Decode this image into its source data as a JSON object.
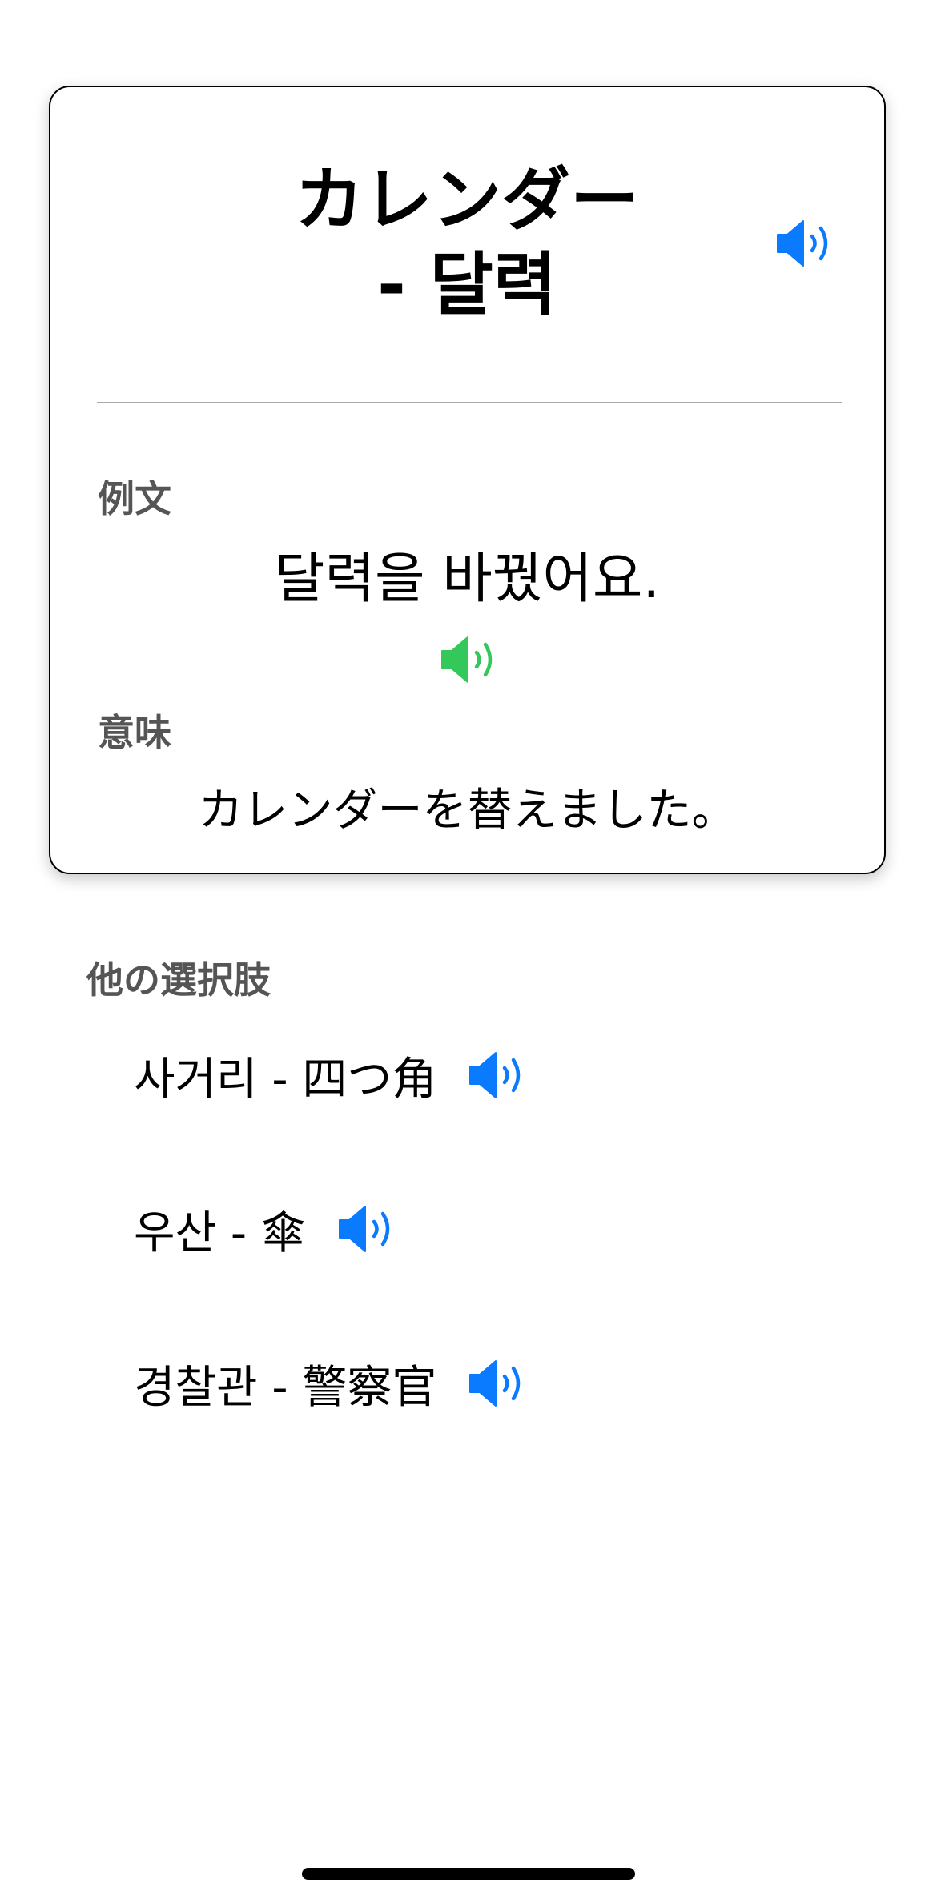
{
  "card": {
    "title_line1": "カレンダー",
    "title_line2": "- 달력",
    "example_label": "例文",
    "example_text": "달력을 바꿨어요.",
    "meaning_label": "意味",
    "meaning_text": "カレンダーを替えました。"
  },
  "others": {
    "label": "他の選択肢",
    "options": [
      {
        "text": "사거리 - 四つ角"
      },
      {
        "text": "우산 - 傘"
      },
      {
        "text": "경찰관 - 警察官"
      }
    ]
  },
  "icons": {
    "speaker": "speaker-icon"
  },
  "colors": {
    "speaker_blue": "#0A7AFF",
    "speaker_green": "#34C759",
    "label_gray": "#555555",
    "divider": "#A9A9A9"
  }
}
